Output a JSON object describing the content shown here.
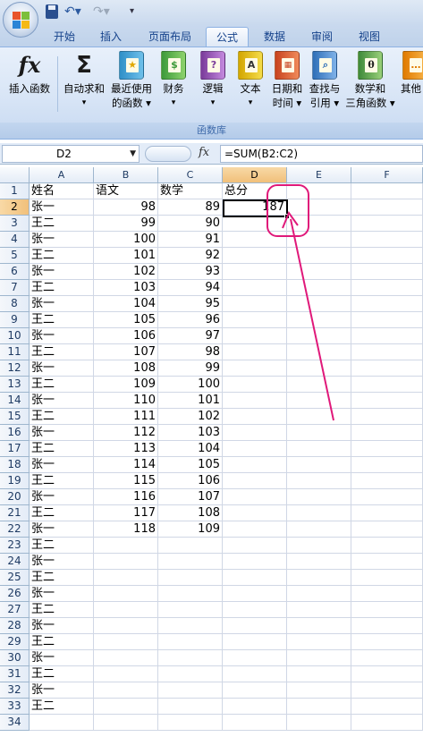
{
  "tabs": [
    "开始",
    "插入",
    "页面布局",
    "公式",
    "数据",
    "审阅",
    "视图"
  ],
  "active_tab": "公式",
  "ribbon": {
    "buttons": [
      {
        "line1": "插入函数",
        "line2": ""
      },
      {
        "line1": "自动求和",
        "line2": "▾"
      },
      {
        "line1": "最近使用",
        "line2": "的函数 ▾"
      },
      {
        "line1": "财务",
        "line2": "▾"
      },
      {
        "line1": "逻辑",
        "line2": "▾"
      },
      {
        "line1": "文本",
        "line2": "▾"
      },
      {
        "line1": "日期和",
        "line2": "时间 ▾"
      },
      {
        "line1": "查找与",
        "line2": "引用 ▾"
      },
      {
        "line1": "数学和",
        "line2": "三角函数 ▾"
      },
      {
        "line1": "其他",
        "line2": ""
      }
    ],
    "group_label": "函数库",
    "icons": {
      "insert_function": "fx",
      "autosum": "Σ",
      "math": "θ",
      "text": "A",
      "logic": "?"
    }
  },
  "formula_bar": {
    "name_box": "D2",
    "fx_label": "fx",
    "formula": "=SUM(B2:C2)"
  },
  "sheet": {
    "columns": [
      "A",
      "B",
      "C",
      "D",
      "E",
      "F"
    ],
    "active_column": "D",
    "active_row": 2,
    "rows": [
      {
        "n": "1",
        "a": "姓名",
        "b": "语文",
        "c": "数学",
        "d": "总分"
      },
      {
        "n": "2",
        "a": "张一",
        "b": "98",
        "c": "89",
        "d": "187"
      },
      {
        "n": "3",
        "a": "王二",
        "b": "99",
        "c": "90",
        "d": ""
      },
      {
        "n": "4",
        "a": "张一",
        "b": "100",
        "c": "91",
        "d": ""
      },
      {
        "n": "5",
        "a": "王二",
        "b": "101",
        "c": "92",
        "d": ""
      },
      {
        "n": "6",
        "a": "张一",
        "b": "102",
        "c": "93",
        "d": ""
      },
      {
        "n": "7",
        "a": "王二",
        "b": "103",
        "c": "94",
        "d": ""
      },
      {
        "n": "8",
        "a": "张一",
        "b": "104",
        "c": "95",
        "d": ""
      },
      {
        "n": "9",
        "a": "王二",
        "b": "105",
        "c": "96",
        "d": ""
      },
      {
        "n": "10",
        "a": "张一",
        "b": "106",
        "c": "97",
        "d": ""
      },
      {
        "n": "11",
        "a": "王二",
        "b": "107",
        "c": "98",
        "d": ""
      },
      {
        "n": "12",
        "a": "张一",
        "b": "108",
        "c": "99",
        "d": ""
      },
      {
        "n": "13",
        "a": "王二",
        "b": "109",
        "c": "100",
        "d": ""
      },
      {
        "n": "14",
        "a": "张一",
        "b": "110",
        "c": "101",
        "d": ""
      },
      {
        "n": "15",
        "a": "王二",
        "b": "111",
        "c": "102",
        "d": ""
      },
      {
        "n": "16",
        "a": "张一",
        "b": "112",
        "c": "103",
        "d": ""
      },
      {
        "n": "17",
        "a": "王二",
        "b": "113",
        "c": "104",
        "d": ""
      },
      {
        "n": "18",
        "a": "张一",
        "b": "114",
        "c": "105",
        "d": ""
      },
      {
        "n": "19",
        "a": "王二",
        "b": "115",
        "c": "106",
        "d": ""
      },
      {
        "n": "20",
        "a": "张一",
        "b": "116",
        "c": "107",
        "d": ""
      },
      {
        "n": "21",
        "a": "王二",
        "b": "117",
        "c": "108",
        "d": ""
      },
      {
        "n": "22",
        "a": "张一",
        "b": "118",
        "c": "109",
        "d": ""
      },
      {
        "n": "23",
        "a": "王二",
        "b": "",
        "c": "",
        "d": ""
      },
      {
        "n": "24",
        "a": "张一",
        "b": "",
        "c": "",
        "d": ""
      },
      {
        "n": "25",
        "a": "王二",
        "b": "",
        "c": "",
        "d": ""
      },
      {
        "n": "26",
        "a": "张一",
        "b": "",
        "c": "",
        "d": ""
      },
      {
        "n": "27",
        "a": "王二",
        "b": "",
        "c": "",
        "d": ""
      },
      {
        "n": "28",
        "a": "张一",
        "b": "",
        "c": "",
        "d": ""
      },
      {
        "n": "29",
        "a": "王二",
        "b": "",
        "c": "",
        "d": ""
      },
      {
        "n": "30",
        "a": "张一",
        "b": "",
        "c": "",
        "d": ""
      },
      {
        "n": "31",
        "a": "王二",
        "b": "",
        "c": "",
        "d": ""
      },
      {
        "n": "32",
        "a": "张一",
        "b": "",
        "c": "",
        "d": ""
      },
      {
        "n": "33",
        "a": "王二",
        "b": "",
        "c": "",
        "d": ""
      },
      {
        "n": "34",
        "a": "",
        "b": "",
        "c": "",
        "d": ""
      }
    ]
  },
  "colors": {
    "annotation": "#e0197a",
    "active_header": "#f1c07a",
    "ribbon_text": "#15428b"
  }
}
